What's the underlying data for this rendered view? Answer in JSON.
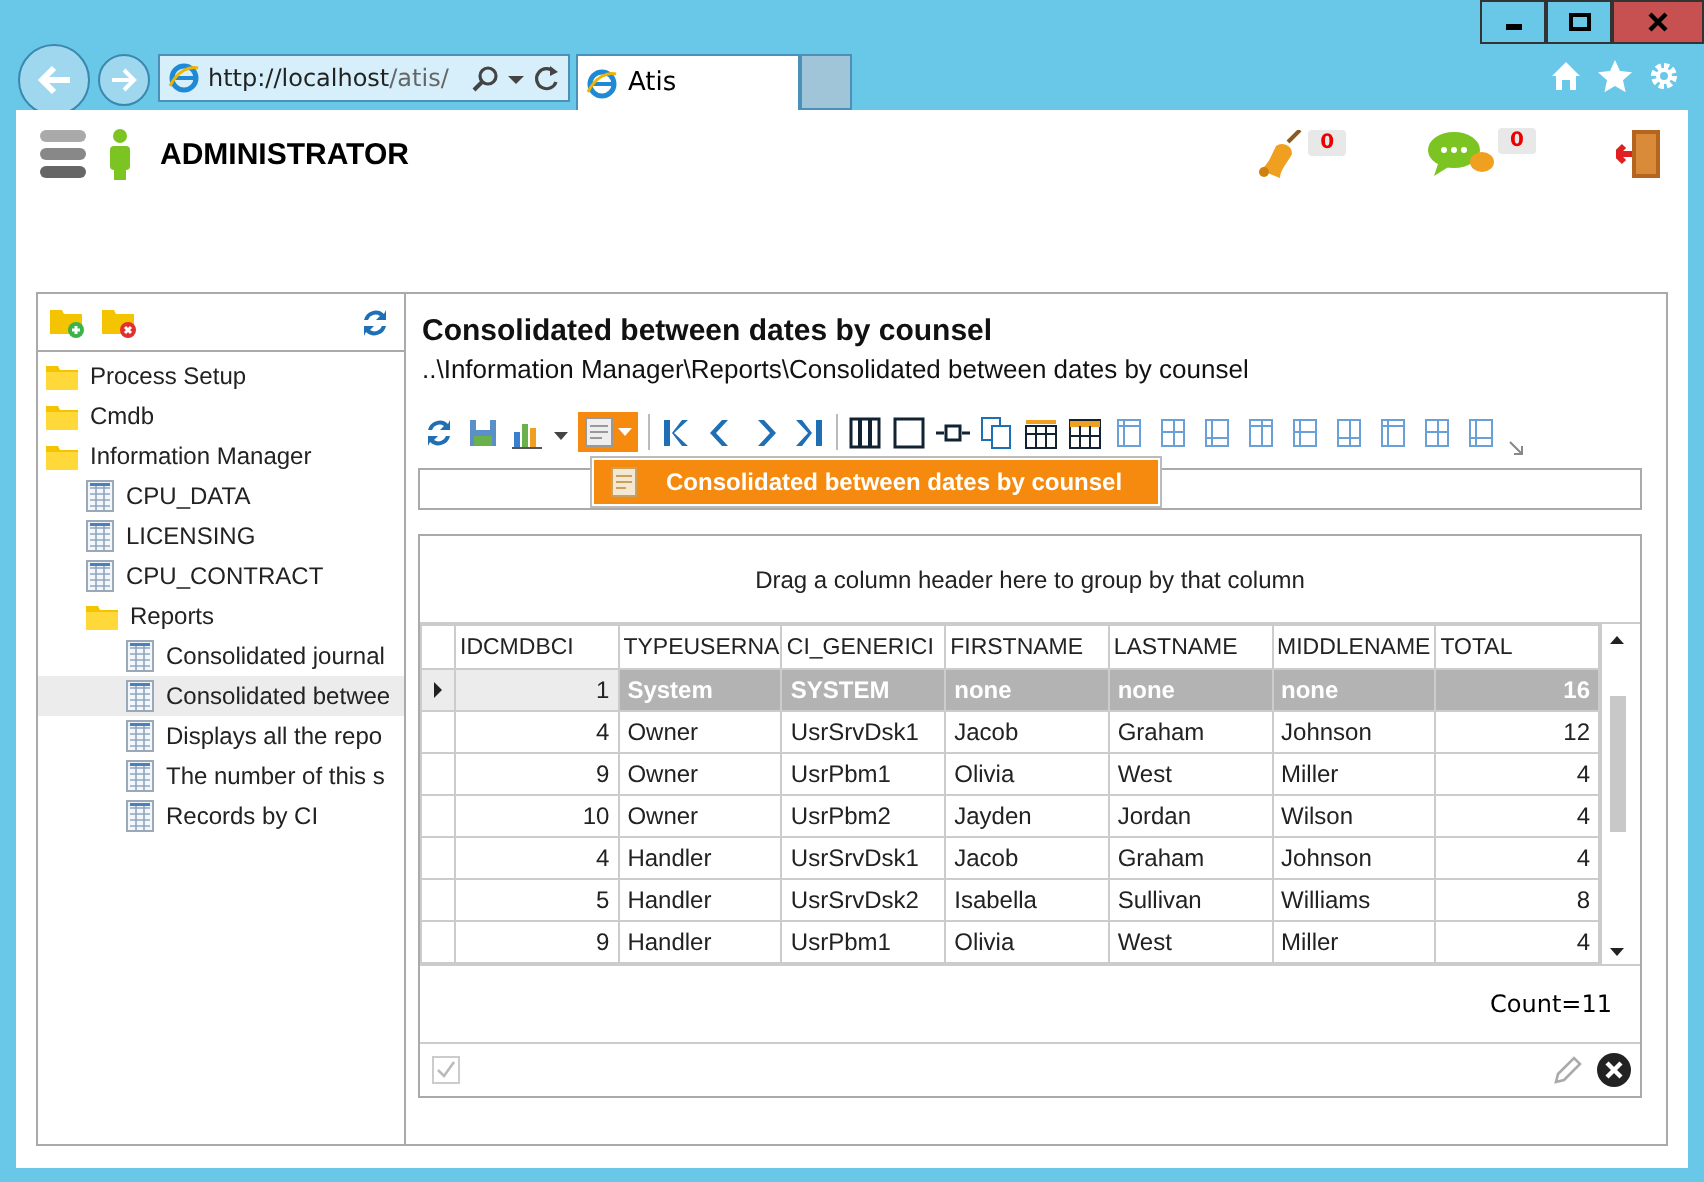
{
  "browser": {
    "url_host": "http://localhost",
    "url_path": "/atis/",
    "tab_title": "Atis"
  },
  "header": {
    "title": "ADMINISTRATOR",
    "counters": [
      {
        "kind": "bell",
        "count": "0"
      },
      {
        "kind": "chat",
        "count": "0"
      }
    ]
  },
  "tree": [
    {
      "label": "Process Setup",
      "kind": "folder",
      "selected": false
    },
    {
      "label": "Cmdb",
      "kind": "folder",
      "selected": false
    },
    {
      "label": "Information Manager",
      "kind": "folder",
      "selected": false,
      "children": [
        {
          "label": "CPU_DATA",
          "kind": "table",
          "selected": false
        },
        {
          "label": "LICENSING",
          "kind": "table",
          "selected": false
        },
        {
          "label": "CPU_CONTRACT",
          "kind": "table",
          "selected": false
        },
        {
          "label": "Reports",
          "kind": "folder",
          "selected": false,
          "children": [
            {
              "label": "Consolidated journal",
              "kind": "table",
              "selected": false
            },
            {
              "label": "Consolidated betwee",
              "kind": "table",
              "selected": true
            },
            {
              "label": "Displays all the repo",
              "kind": "table",
              "selected": false
            },
            {
              "label": "The number of this s",
              "kind": "table",
              "selected": false
            },
            {
              "label": "Records by CI",
              "kind": "table",
              "selected": false
            }
          ]
        }
      ]
    }
  ],
  "report": {
    "title": "Consolidated between dates by counsel",
    "path": "..\\Information Manager\\Reports\\Consolidated between dates by counsel",
    "menu": [
      {
        "label": "Consolidated between dates by counsel",
        "selected": true
      }
    ],
    "grid": {
      "group_hint": "Drag a column header here to group by that column",
      "columns": [
        "IDCMDBCI",
        "TYPEUSERNA",
        "CI_GENERICI",
        "FIRSTNAME",
        "LASTNAME",
        "MIDDLENAME",
        "TOTAL"
      ],
      "rows": [
        {
          "selected": true,
          "cells": [
            "1",
            "System",
            "SYSTEM",
            "none",
            "none",
            "none",
            "16"
          ]
        },
        {
          "selected": false,
          "cells": [
            "4",
            "Owner",
            "UsrSrvDsk1",
            "Jacob",
            "Graham",
            "Johnson",
            "12"
          ]
        },
        {
          "selected": false,
          "cells": [
            "9",
            "Owner",
            "UsrPbm1",
            "Olivia",
            "West",
            "Miller",
            "4"
          ]
        },
        {
          "selected": false,
          "cells": [
            "10",
            "Owner",
            "UsrPbm2",
            "Jayden",
            "Jordan",
            "Wilson",
            "4"
          ]
        },
        {
          "selected": false,
          "cells": [
            "4",
            "Handler",
            "UsrSrvDsk1",
            "Jacob",
            "Graham",
            "Johnson",
            "4"
          ]
        },
        {
          "selected": false,
          "cells": [
            "5",
            "Handler",
            "UsrSrvDsk2",
            "Isabella",
            "Sullivan",
            "Williams",
            "8"
          ]
        },
        {
          "selected": false,
          "cells": [
            "9",
            "Handler",
            "UsrPbm1",
            "Olivia",
            "West",
            "Miller",
            "4"
          ]
        }
      ],
      "count": "Count=11"
    }
  }
}
